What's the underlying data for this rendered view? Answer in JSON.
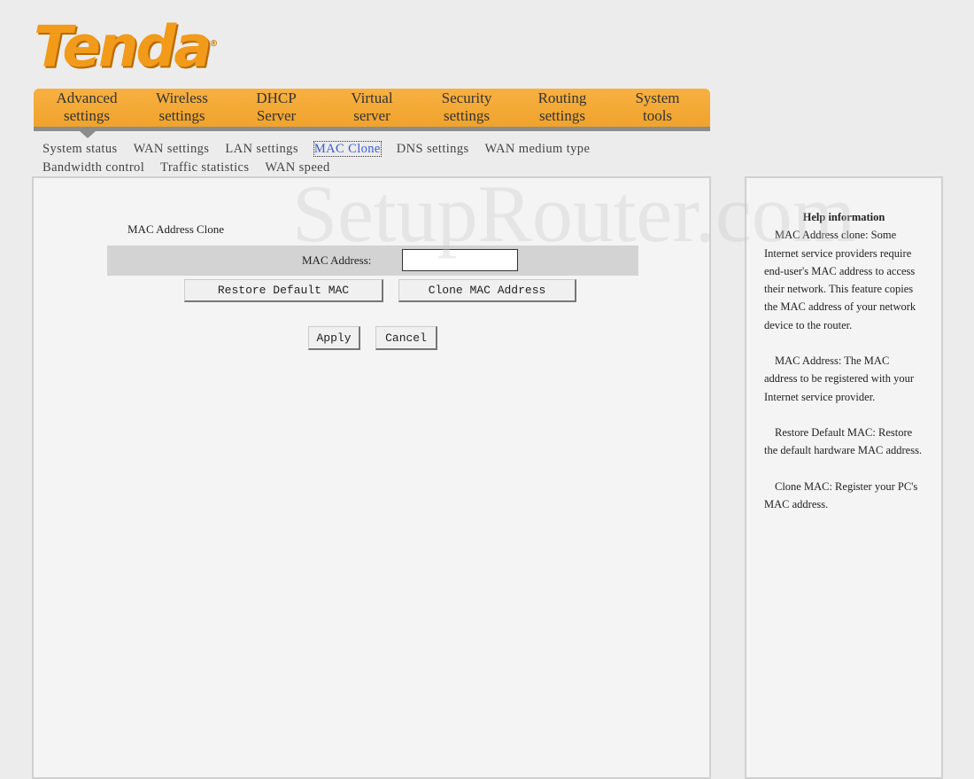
{
  "logo": {
    "text": "Tenda",
    "mark": "®"
  },
  "nav": {
    "items": [
      {
        "l1": "Advanced",
        "l2": "settings"
      },
      {
        "l1": "Wireless",
        "l2": "settings"
      },
      {
        "l1": "DHCP",
        "l2": "Server"
      },
      {
        "l1": "Virtual",
        "l2": "server"
      },
      {
        "l1": "Security",
        "l2": "settings"
      },
      {
        "l1": "Routing",
        "l2": "settings"
      },
      {
        "l1": "System",
        "l2": "tools"
      }
    ],
    "active": "Advanced settings",
    "accent": "#f2a534"
  },
  "subnav": {
    "items": [
      "System status",
      "WAN settings",
      "LAN settings",
      "MAC Clone",
      "DNS settings",
      "WAN medium type",
      "Bandwidth control",
      "Traffic statistics",
      "WAN speed"
    ],
    "active": "MAC Clone"
  },
  "form": {
    "title": "MAC Address Clone",
    "mac_label": "MAC Address:",
    "mac_value": "",
    "restore_label": "Restore Default MAC",
    "clone_label": "Clone MAC Address",
    "apply_label": "Apply",
    "cancel_label": "Cancel"
  },
  "help": {
    "title": "Help information",
    "paragraphs": [
      "MAC Address clone: Some Internet service providers require end-user's MAC address to access their network. This feature copies the MAC address of your network device to the router.",
      "MAC Address: The MAC address to be registered with your Internet service provider.",
      "Restore Default MAC: Restore the default hardware MAC address.",
      "Clone MAC: Register your PC's MAC address."
    ]
  },
  "watermark": "SetupRouter.com"
}
